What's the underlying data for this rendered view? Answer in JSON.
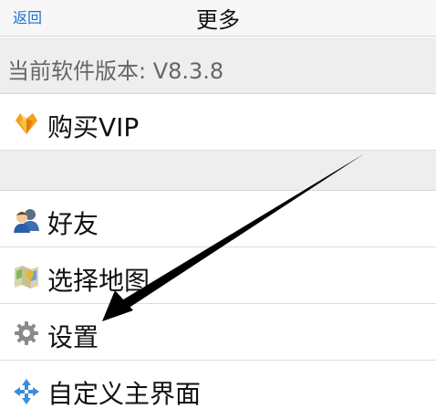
{
  "nav": {
    "back_label": "返回",
    "title": "更多"
  },
  "version": {
    "text": "当前软件版本: V8.3.8"
  },
  "menu": {
    "vip": {
      "label": "购买VIP",
      "icon": "vip-heart-icon"
    },
    "friends": {
      "label": "好友",
      "icon": "friends-icon"
    },
    "map": {
      "label": "选择地图",
      "icon": "map-icon"
    },
    "settings": {
      "label": "设置",
      "icon": "gear-icon"
    },
    "custom": {
      "label": "自定义主界面",
      "icon": "arrows-cross-icon"
    }
  },
  "colors": {
    "accent": "#1f6fd1",
    "section_bg": "#eeeeef",
    "separator": "#d6d6d8"
  }
}
